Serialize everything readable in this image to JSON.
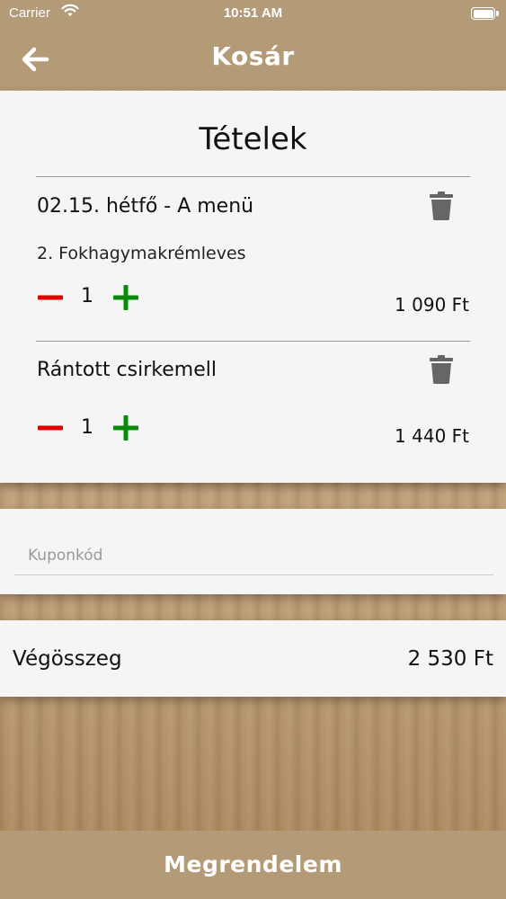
{
  "status_bar": {
    "carrier": "Carrier",
    "time": "10:51 AM"
  },
  "nav": {
    "title": "Kosár",
    "back_icon": "arrow-left-icon"
  },
  "items_section": {
    "heading": "Tételek",
    "items": [
      {
        "title": "02.15. hétfő - A menü",
        "subtitle": "2. Fokhagymakrémleves",
        "quantity": "1",
        "price": "1 090 Ft"
      },
      {
        "title": "Rántott csirkemell",
        "subtitle": "",
        "quantity": "1",
        "price": "1 440 Ft"
      }
    ]
  },
  "coupon": {
    "placeholder": "Kuponkód",
    "value": ""
  },
  "total": {
    "label": "Végösszeg",
    "value": "2 530 Ft"
  },
  "order_button": {
    "label": "Megrendelem"
  },
  "colors": {
    "header": "#b39b78",
    "minus": "#e00000",
    "plus": "#0a8a0a",
    "trash": "#666666"
  }
}
